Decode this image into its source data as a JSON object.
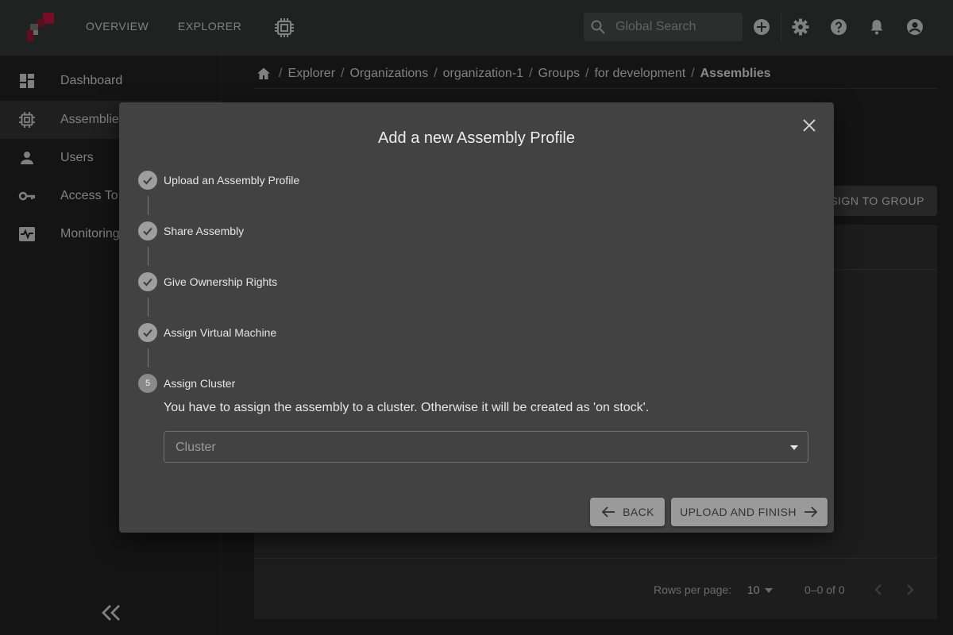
{
  "topbar": {
    "nav": [
      {
        "label": "OVERVIEW"
      },
      {
        "label": "EXPLORER"
      }
    ],
    "search_placeholder": "Global Search",
    "icons": [
      "add-icon",
      "gear-icon",
      "help-icon",
      "bell-icon",
      "account-icon"
    ]
  },
  "sidebar": {
    "items": [
      {
        "label": "Dashboard",
        "icon": "dashboard-icon"
      },
      {
        "label": "Assemblies",
        "icon": "chip-icon",
        "active": true
      },
      {
        "label": "Users",
        "icon": "person-icon"
      },
      {
        "label": "Access To",
        "icon": "key-icon"
      },
      {
        "label": "Monitoring",
        "icon": "monitor-icon"
      }
    ]
  },
  "breadcrumb": {
    "items": [
      "Explorer",
      "Organizations",
      "organization-1",
      "Groups",
      "for development"
    ],
    "current": "Assemblies"
  },
  "main": {
    "assign_label": "ASSIGN TO GROUP",
    "pagination": {
      "rows_label": "Rows per page:",
      "rows_value": "10",
      "range": "0–0 of 0"
    }
  },
  "dialog": {
    "title": "Add a new Assembly Profile",
    "steps": [
      {
        "label": "Upload an Assembly Profile",
        "done": true
      },
      {
        "label": "Share Assembly",
        "done": true
      },
      {
        "label": "Give Ownership Rights",
        "done": true
      },
      {
        "label": "Assign Virtual Machine",
        "done": true
      },
      {
        "label": "Assign Cluster",
        "number": "5",
        "done": false
      }
    ],
    "description": "You have to assign the assembly to a cluster. Otherwise it will be created as 'on stock'.",
    "cluster_placeholder": "Cluster",
    "back_label": "BACK",
    "finish_label": "UPLOAD AND FINISH"
  },
  "colors": {
    "topbar": "#303333",
    "dialog": "#424242",
    "logo_accent": "#b0123a",
    "button": "#9a9a9a"
  }
}
